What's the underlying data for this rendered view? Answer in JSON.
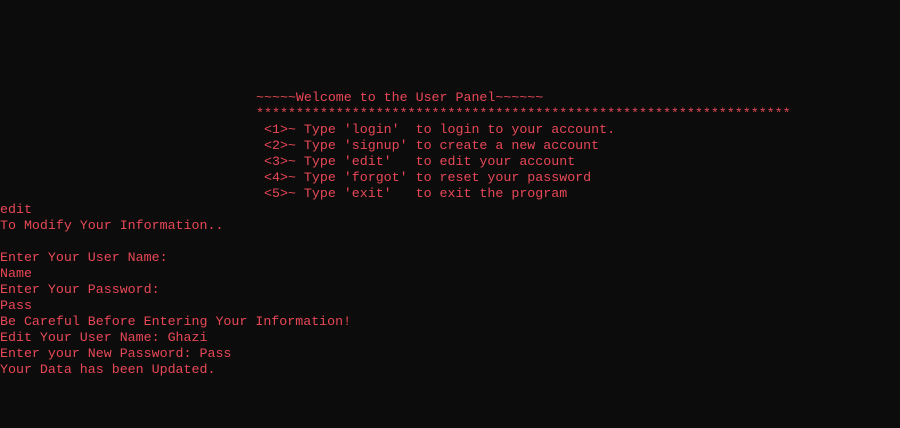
{
  "accent_color": "#e74856",
  "background_color": "#0c0c0c",
  "banner": {
    "title": "~~~~~Welcome to the User Panel~~~~~~",
    "separator": "*******************************************************************"
  },
  "menu": {
    "items": [
      " <1>~ Type 'login'  to login to your account.",
      " <2>~ Type 'signup' to create a new account",
      " <3>~ Type 'edit'   to edit your account",
      " <4>~ Type 'forgot' to reset your password",
      " <5>~ Type 'exit'   to exit the program"
    ]
  },
  "session": {
    "command": "edit",
    "intro": "To Modify Your Information..",
    "prompt_user": "Enter Your User Name:",
    "input_user": "Name",
    "prompt_pass": "Enter Your Password:",
    "input_pass": "Pass",
    "warning": "Be Careful Before Entering Your Information!",
    "edit_user": "Edit Your User Name: Ghazi",
    "new_pass": "Enter your New Password: Pass",
    "result": "Your Data has been Updated."
  }
}
